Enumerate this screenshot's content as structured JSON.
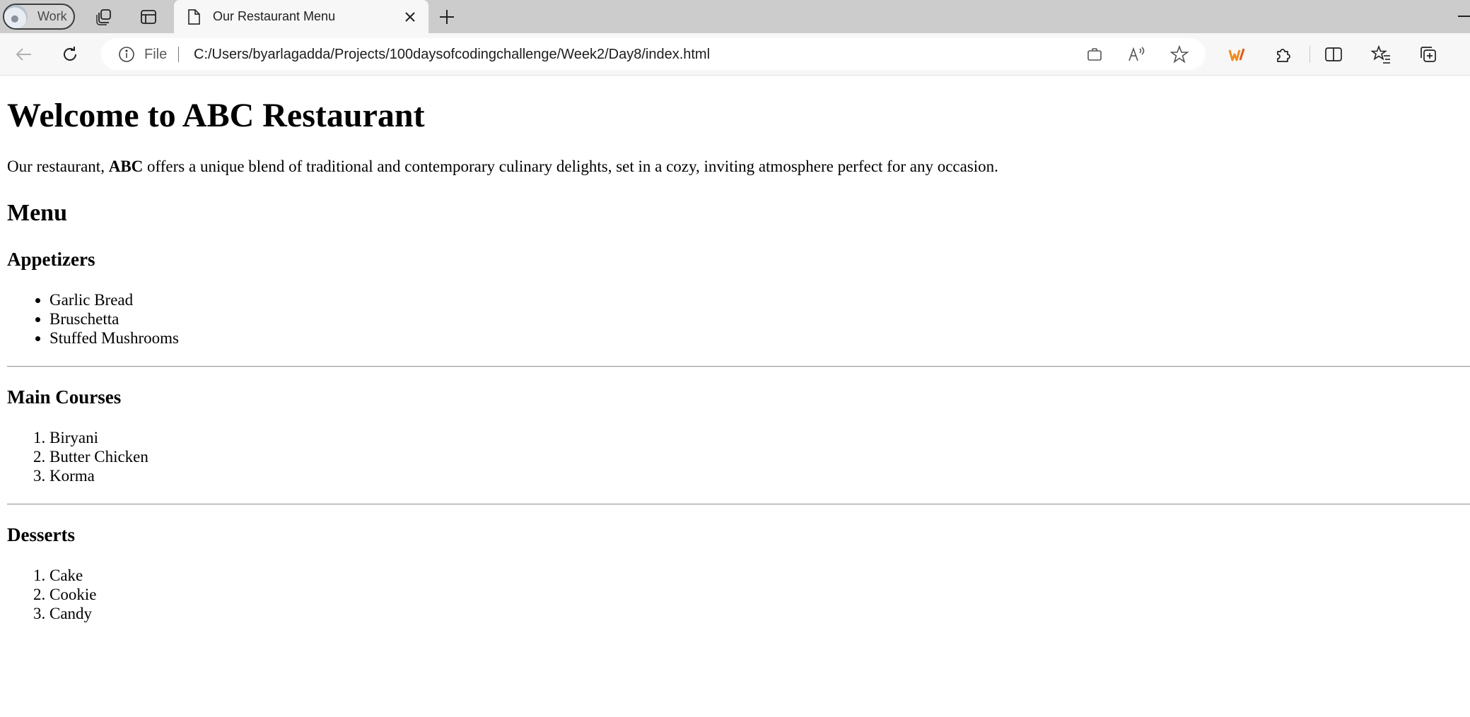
{
  "browser": {
    "profile_label": "Work",
    "tab_title": "Our Restaurant Menu",
    "address": {
      "scheme_label": "File",
      "url": "C:/Users/byarlagadda/Projects/100daysofcodingchallenge/Week2/Day8/index.html"
    },
    "icons": {
      "workspaces": "workspaces-icon",
      "tab_actions": "tab-actions-icon",
      "tab_page": "document-icon",
      "close": "close-icon",
      "new_tab": "plus-icon",
      "back": "back-arrow-icon",
      "refresh": "refresh-icon",
      "info": "info-icon",
      "app_available": "app-available-icon",
      "read_aloud": "read-aloud-icon",
      "favorite": "star-icon",
      "extension_brand": "brand-extension-icon",
      "extensions": "puzzle-icon",
      "split_screen": "split-screen-icon",
      "favorites": "favorites-icon",
      "collections": "collections-icon"
    },
    "colors": {
      "tabstrip": "#cccccc",
      "toolbar": "#f7f7f7",
      "brand_extension": "#f28b20"
    }
  },
  "page": {
    "title": "Welcome to ABC Restaurant",
    "intro": {
      "before": "Our restaurant, ",
      "bold": "ABC",
      "after": " offers a unique blend of traditional and contemporary culinary delights, set in a cozy, inviting atmosphere perfect for any occasion."
    },
    "menu_heading": "Menu",
    "sections": [
      {
        "heading": "Appetizers",
        "list_type": "unordered",
        "items": [
          "Garlic Bread",
          "Bruschetta",
          "Stuffed Mushrooms"
        ]
      },
      {
        "heading": "Main Courses",
        "list_type": "ordered",
        "items": [
          "Biryani",
          "Butter Chicken",
          "Korma"
        ]
      },
      {
        "heading": "Desserts",
        "list_type": "ordered",
        "items": [
          "Cake",
          "Cookie",
          "Candy"
        ]
      }
    ]
  }
}
